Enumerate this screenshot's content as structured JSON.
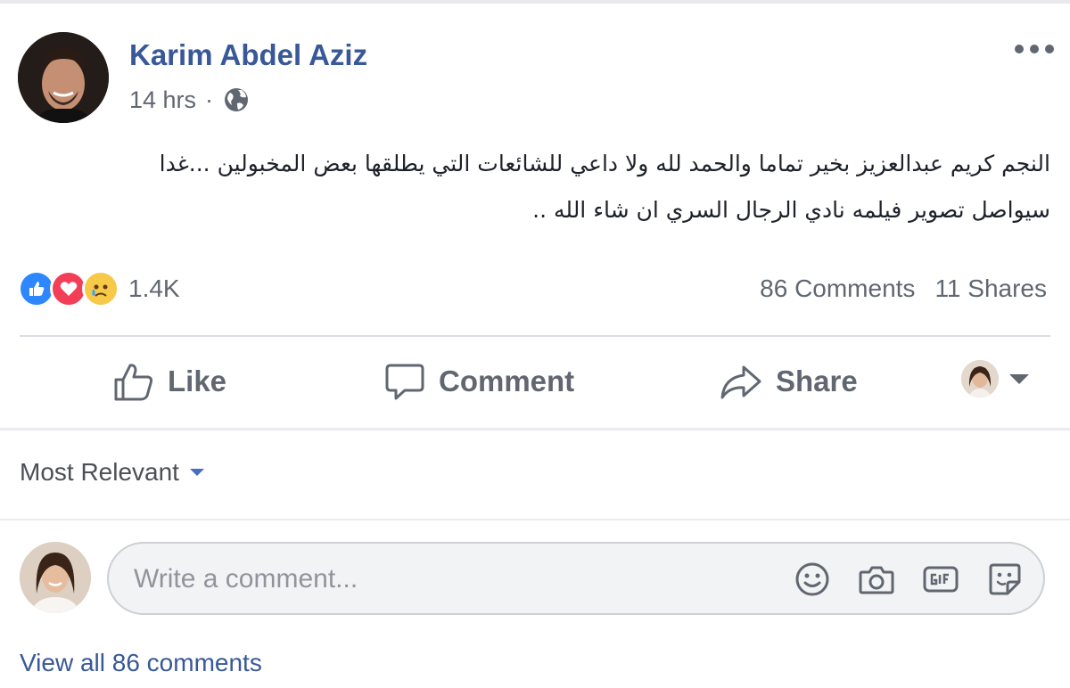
{
  "post": {
    "author": "Karim Abdel Aziz",
    "timestamp": "14 hrs",
    "separator": "·",
    "privacy_icon": "globe-icon",
    "more_icon": "ellipsis-icon",
    "text_line_1": "النجم كريم عبدالعزيز بخير تماما والحمد لله ولا داعي للشائعات التي يطلقها بعض المخبولين ...غدا",
    "text_line_2": "سيواصل تصوير فيلمه نادي الرجال السري ان شاء الله .."
  },
  "stats": {
    "reaction_icons": [
      "like-icon",
      "love-icon",
      "sad-icon"
    ],
    "reaction_count": "1.4K",
    "comments": "86 Comments",
    "shares": "11 Shares"
  },
  "actions": {
    "like": "Like",
    "comment": "Comment",
    "share": "Share"
  },
  "comments": {
    "sort_label": "Most Relevant",
    "input_placeholder": "Write a comment...",
    "composer_icons": [
      "emoji-icon",
      "camera-icon",
      "gif-icon",
      "sticker-icon"
    ],
    "view_all": "View all 86 comments"
  },
  "colors": {
    "author": "#385898",
    "secondary_text": "#606770",
    "like_blue": "#2d88ff",
    "love_red": "#f33e58",
    "sad_yellow": "#f7c948"
  }
}
